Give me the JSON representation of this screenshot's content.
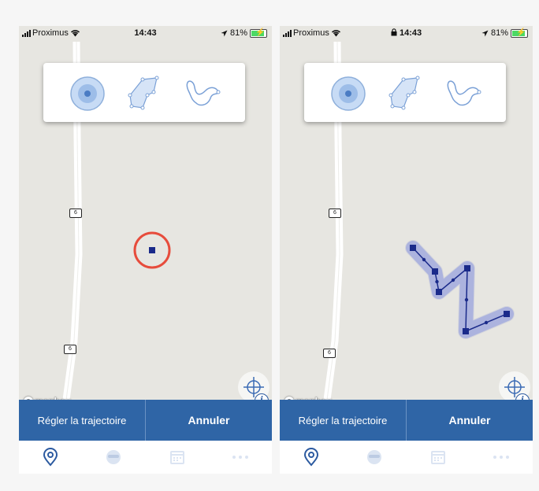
{
  "colors": {
    "map_background": "#e7e6e1",
    "road": "#ffffff",
    "accent_blue": "#2f65a6",
    "marker_navy": "#1a2a8a",
    "highlight_red": "#e74c3c",
    "tab_active": "#2c5aa0",
    "tab_inactive": "#cfd9ea"
  },
  "screens": [
    {
      "status_bar": {
        "carrier": "Proximus",
        "time": "14:43",
        "battery": "81%",
        "lock": false
      },
      "tools": [
        {
          "name": "point-tool",
          "icon": "point-circle-icon",
          "selected": true
        },
        {
          "name": "polygon-tool",
          "icon": "polygon-icon",
          "selected": false
        },
        {
          "name": "path-tool",
          "icon": "freehand-path-icon",
          "selected": false
        }
      ],
      "map": {
        "road_shield_labels": [
          "6",
          "6"
        ],
        "attribution": "mapbox",
        "selection": "single-point"
      },
      "actions": {
        "secondary_label": "Régler la trajectoire",
        "primary_label": "Annuler"
      },
      "tabs": [
        {
          "icon": "map-pin-icon",
          "active": true
        },
        {
          "icon": "face-icon",
          "active": false
        },
        {
          "icon": "calendar-icon",
          "active": false
        },
        {
          "icon": "more-dots-icon",
          "active": false
        }
      ]
    },
    {
      "status_bar": {
        "carrier": "Proximus",
        "time": "14:43",
        "battery": "81%",
        "lock": true
      },
      "tools": [
        {
          "name": "point-tool",
          "icon": "point-circle-icon",
          "selected": true
        },
        {
          "name": "polygon-tool",
          "icon": "polygon-icon",
          "selected": false
        },
        {
          "name": "path-tool",
          "icon": "freehand-path-icon",
          "selected": false
        }
      ],
      "map": {
        "road_shield_labels": [
          "6",
          "6"
        ],
        "attribution": "mapbox",
        "selection": "trajectory-path"
      },
      "actions": {
        "secondary_label": "Régler la trajectoire",
        "primary_label": "Annuler"
      },
      "tabs": [
        {
          "icon": "map-pin-icon",
          "active": true
        },
        {
          "icon": "face-icon",
          "active": false
        },
        {
          "icon": "calendar-icon",
          "active": false
        },
        {
          "icon": "more-dots-icon",
          "active": false
        }
      ]
    }
  ]
}
